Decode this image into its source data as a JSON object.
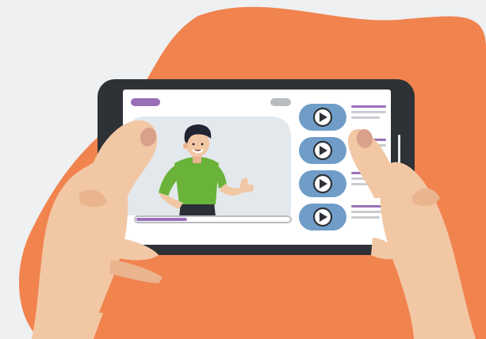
{
  "scene": {
    "description_colors": {
      "background": "#eef0f1",
      "blob": "#f1834f",
      "phone_body": "#2e3136",
      "screen": "#ffffff",
      "video_bg": "#e3e8ec",
      "accent": "#9a6fb8",
      "thumb_button": "#6f9dc8",
      "skin": "#f2c7a4",
      "skin_shadow": "#e9b48e",
      "nail": "#d9a08a",
      "shirt": "#6ab33a",
      "hair": "#1f2430",
      "pants": "#2b2f38",
      "line_gray": "#c9ccd0"
    }
  },
  "player": {
    "progress": 0.33,
    "play_icon": "play-icon"
  },
  "playlist": {
    "count": 4,
    "icon": "play-circle-icon"
  }
}
